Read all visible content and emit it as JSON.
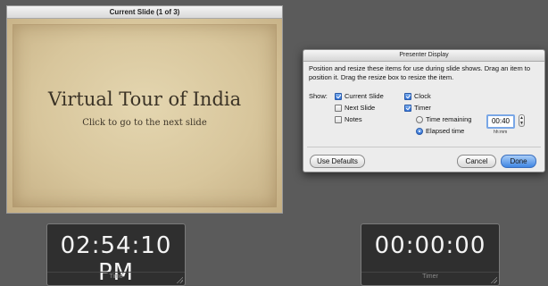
{
  "slide_panel": {
    "title": "Current Slide (1 of 3)",
    "slide_title": "Virtual Tour of India",
    "slide_subtitle": "Click to go to the next slide"
  },
  "clock": {
    "value": "02:54:10 PM",
    "caption": "Time"
  },
  "timer": {
    "value": "00:00:00",
    "caption": "Timer"
  },
  "dialog": {
    "title": "Presenter Display",
    "instructions": "Position and resize these items for use during slide shows. Drag an item to position it. Drag the resize box to resize the item.",
    "show_label": "Show:",
    "options": {
      "current_slide": {
        "label": "Current Slide",
        "checked": true
      },
      "next_slide": {
        "label": "Next Slide",
        "checked": false
      },
      "notes": {
        "label": "Notes",
        "checked": false
      },
      "clock": {
        "label": "Clock",
        "checked": true
      },
      "timer": {
        "label": "Timer",
        "checked": true
      }
    },
    "timer_mode": {
      "time_remaining_label": "Time remaining",
      "elapsed_time_label": "Elapsed time",
      "selected": "Elapsed time",
      "time_value": "00:40",
      "time_format_hint": "hh:mm"
    },
    "buttons": {
      "use_defaults": "Use Defaults",
      "cancel": "Cancel",
      "done": "Done"
    }
  }
}
